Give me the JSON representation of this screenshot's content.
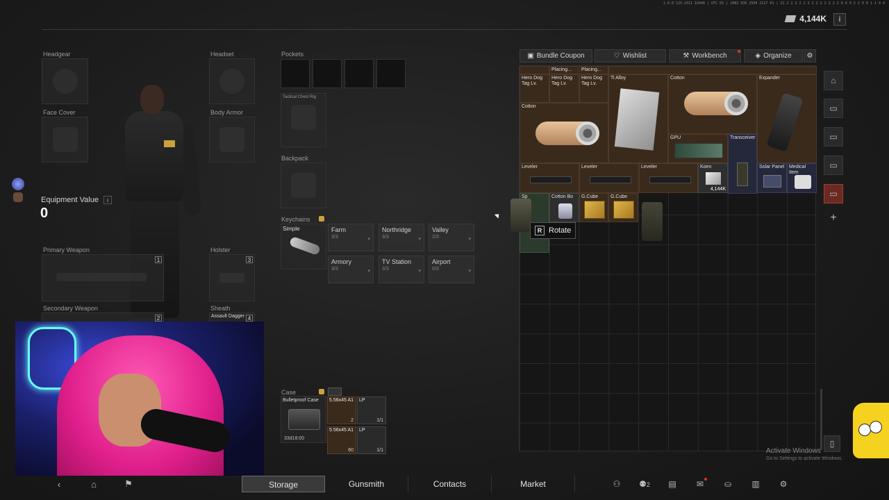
{
  "header": {
    "top_string": "1.0.0 125.1011 10446 | UTC 01 | 1082 930 2500 2117 01 | 21 2 2 2 2 2 2 2 2 2 2 2 2 2 0 0 0 2 2 0 0 1 1 4 4",
    "currency": "4,144K",
    "info": "i"
  },
  "equipment": {
    "headgear": "Headgear",
    "headset": "Headset",
    "face_cover": "Face Cover",
    "body_armor": "Body Armor",
    "value_label": "Equipment Value",
    "value_info": "i",
    "value": "0",
    "primary": "Primary Weapon",
    "primary_num": "1",
    "holster": "Holster",
    "holster_num": "3",
    "secondary": "Secondary Weapon",
    "secondary_num": "2",
    "sheath": "Sheath",
    "sheath_item": "Assault Dagger",
    "sheath_num": "4"
  },
  "gear": {
    "pockets": "Pockets",
    "chest_rig": "Tactical Chest Rig",
    "backpack": "Backpack",
    "keychains": "Keychains",
    "keychain_simple": "Simple",
    "keychain_slots": [
      {
        "name": "Farm",
        "count": "3/3"
      },
      {
        "name": "Northridge",
        "count": "3/3"
      },
      {
        "name": "Valley",
        "count": "2/3"
      },
      {
        "name": "Armory",
        "count": "3/3"
      },
      {
        "name": "TV Station",
        "count": "3/3"
      },
      {
        "name": "Airport",
        "count": "0/3"
      }
    ],
    "case": "Case",
    "case_item": "Bulletproof Case",
    "case_timer": "33d18:00",
    "case_slots": [
      {
        "name": "5.56x45 A1",
        "count": "2"
      },
      {
        "name": "LP",
        "count": "1/1"
      },
      {
        "name": "5.56x45 A1",
        "count": "60"
      },
      {
        "name": "LP",
        "count": "1/1"
      }
    ]
  },
  "stash": {
    "tabs": [
      {
        "label": "Bundle Coupon",
        "icon": "coupon-icon"
      },
      {
        "label": "Wishlist",
        "icon": "heart-icon"
      },
      {
        "label": "Workbench",
        "icon": "wrench-icon"
      },
      {
        "label": "Organize",
        "icon": "organize-icon"
      }
    ],
    "items": {
      "placing1": "Placing...",
      "placing2": "Placing...",
      "dogtag1": "Hero Dog Tag Lv.",
      "dogtag2": "Hero Dog Tag Lv.",
      "dogtag3": "Hero Dog Tag Lv.",
      "tialloy": "Ti Alloy",
      "cotton1": "Cotton",
      "expander": "Expander",
      "cotton2": "Cotton",
      "gpu": "GPU",
      "transceiver": "Transceiver",
      "leveler1": "Leveler",
      "leveler2": "Leveler",
      "leveler3": "Leveler",
      "koen": "Koen",
      "koen_count": "4,144K",
      "solar": "Solar Panel",
      "medical": "Medical Item",
      "sp": "Sp",
      "cotton_box": "Cotton Bo",
      "gcube1": "G.Cube",
      "gcube2": "G.Cube"
    },
    "tooltip_key": "R",
    "tooltip_label": "Rotate"
  },
  "bottom_nav": {
    "tabs": [
      "Storage",
      "Gunsmith",
      "Contacts",
      "Market"
    ],
    "active": "Storage",
    "friends_count": "2"
  },
  "watermark": {
    "line1": "Activate Windows",
    "line2": "Go to Settings to activate Windows."
  }
}
